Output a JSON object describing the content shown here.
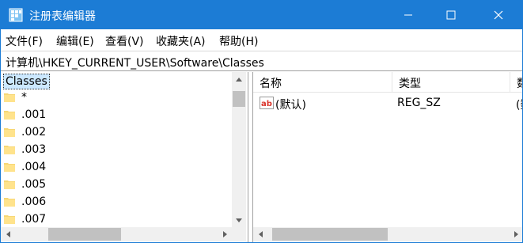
{
  "window": {
    "title": "注册表编辑器",
    "title_bar_color": "#1c7cd5",
    "controls": {
      "minimize_icon": "minimize-icon",
      "maximize_icon": "maximize-icon",
      "close_icon": "close-icon"
    }
  },
  "menu": {
    "items": [
      {
        "label": "文件(F)"
      },
      {
        "label": "编辑(E)"
      },
      {
        "label": "查看(V)"
      },
      {
        "label": "收藏夹(A)"
      },
      {
        "label": "帮助(H)"
      }
    ]
  },
  "address": {
    "path": "计算机\\HKEY_CURRENT_USER\\Software\\Classes"
  },
  "tree": {
    "selected": "Classes",
    "selected_bg": "#cce8ff",
    "items": [
      {
        "label": "*"
      },
      {
        "label": ".001"
      },
      {
        "label": ".002"
      },
      {
        "label": ".003"
      },
      {
        "label": ".004"
      },
      {
        "label": ".005"
      },
      {
        "label": ".006"
      },
      {
        "label": ".007"
      }
    ]
  },
  "list": {
    "columns": [
      {
        "label": "名称"
      },
      {
        "label": "类型"
      },
      {
        "label": "数"
      }
    ],
    "rows": [
      {
        "name": "(默认)",
        "type": "REG_SZ",
        "data": "(数",
        "icon": "string-value-icon"
      }
    ]
  }
}
